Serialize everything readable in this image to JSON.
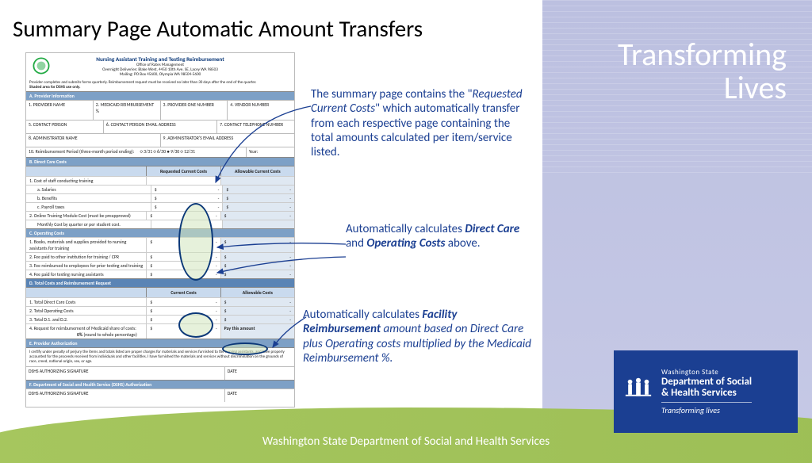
{
  "slide": {
    "title": "Summary Page Automatic Amount Transfers"
  },
  "brand": {
    "l1": "Transforming",
    "l2": "Lives",
    "state": "Washington State",
    "dept1": "Department of Social",
    "dept2": "& Health Services",
    "tag": "Transforming lives",
    "footer": "Washington State Department of Social and Health Services"
  },
  "form": {
    "title": "Nursing Assistant Training and Testing Reimbursement",
    "office": "Office of Rates Management",
    "overnight": "Overnight Deliveries: Blake West, 4450 10th Ave. SE, Lacey WA 98503",
    "mailing": "Mailing: PO Box 45600, Olympia WA 98504-5600",
    "note1": "Provider completes and submits forms quarterly. Reimbursement request must be received no later than 30 days after the end of the quarter.",
    "note2": "Shaded area for DSHS use only.",
    "secA": "A.  Provider Information",
    "a": [
      "1. PROVIDER NAME",
      "2. MEDICAID REIMBURSEMENT %",
      "3. PROVIDER ONE NUMBER",
      "4. VENDOR NUMBER",
      "5. CONTACT PERSON",
      "6. CONTACT PERSON EMAIL ADDRESS",
      "7. CONTACT TELEPHONE NUMBER",
      "8. ADMINISTRATOR NAME",
      "9. ADMINISTRATOR'S EMAIL ADDRESS",
      "10. Reimbursement Period (three-month period ending):",
      "Year:"
    ],
    "quarters": [
      "3/31",
      "6/30",
      "9/30",
      "12/31"
    ],
    "secB": "B.  Direct Care Costs",
    "colReq": "Requested Current Costs",
    "colAll": "Allowable Current Costs",
    "b": [
      "1. Cost of staff conducting training",
      "a. Salaries",
      "b. Benefits",
      "c. Payroll taxes",
      "2. Online Training Module Cost (must be preapproved)",
      "Monthly Cost by quarter or per student cost."
    ],
    "secC": "C.  Operating Costs",
    "c": [
      "1. Books, materials and supplies provided to nursing assistants for training",
      "2. Fee paid to other institution for training / CPR",
      "3. Fee reimbursed to employees for prior testing and training",
      "4. Fee paid for testing nursing assistants"
    ],
    "secD": "D.  Total Costs and Reimbursement Request",
    "dcol1": "Current Costs",
    "dcol2": "Allowable Costs",
    "d": [
      "1. Total Direct Care Costs",
      "2. Total Operating Costs",
      "3. Total D.1. and D.2.",
      "4. Request for reimbursement of Medicaid share of costs:"
    ],
    "pct": "0%",
    "round": "(round to whole percentage)",
    "pay": "Pay this amount",
    "secE": "E.  Provider Authorization",
    "cert": "I certify under penalty of perjury the items and totals listed are proper charges for materials and services furnished to the nursing assistants, and have properly accounted for the proceeds received from individuals and other facilities. I have furnished the materials and services without discrimination on the grounds of race, creed, national origin, sex, or age.",
    "sig1": "DSHS AUTHORIZING SIGNATURE",
    "date": "DATE",
    "secF": "F.  Department of Social and Health Service (DSHS) Authorization"
  },
  "annotations": {
    "a1a": "The summary page contains the \"",
    "a1b": "Requested Current Costs",
    "a1c": "\" which automatically transfer from each respective page containing the total amounts calculated per item/service listed.",
    "a2a": "Automatically calculates ",
    "a2b": "Direct Care",
    "a2c": " and ",
    "a2d": "Operating Costs",
    "a2e": " above.",
    "a3a": "Automatically calculates ",
    "a3b": "Facility Reimbursement",
    "a3c": " amount based on Direct Care plus Operating costs multiplied by the Medicaid Reimbursement %."
  }
}
